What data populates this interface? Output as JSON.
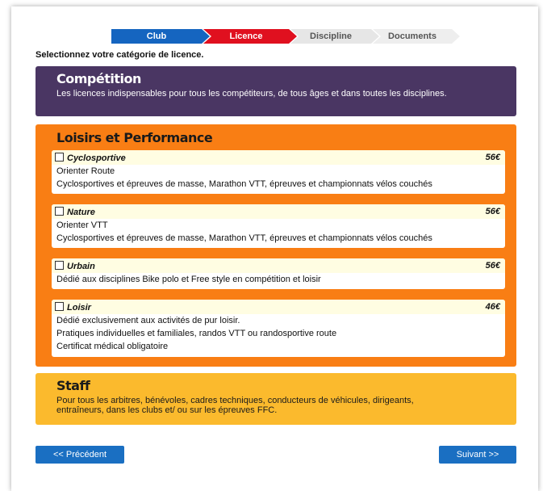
{
  "stepper": {
    "steps": [
      {
        "label": "Club"
      },
      {
        "label": "Licence"
      },
      {
        "label": "Discipline"
      },
      {
        "label": "Documents"
      }
    ]
  },
  "instruction": "Selectionnez votre catégorie de licence.",
  "competition": {
    "title": "Compétition",
    "description": "Les licences indispensables pour tous les compétiteurs, de tous âges et dans toutes les disciplines."
  },
  "loisirs": {
    "title": "Loisirs et Performance",
    "cards": [
      {
        "name": "Cyclosportive",
        "price": "56€",
        "lines": [
          "Orienter Route",
          "Cyclosportives et épreuves de masse, Marathon VTT, épreuves et championnats vélos couchés"
        ]
      },
      {
        "name": "Nature",
        "price": "56€",
        "lines": [
          "Orienter VTT",
          "Cyclosportives et épreuves de masse, Marathon VTT, épreuves et championnats vélos couchés"
        ]
      },
      {
        "name": "Urbain",
        "price": "56€",
        "lines": [
          "Dédié aux disciplines Bike polo et Free style en compétition et loisir"
        ]
      },
      {
        "name": "Loisir",
        "price": "46€",
        "lines": [
          "Dédié exclusivement aux activités de pur loisir.",
          "Pratiques individuelles et familiales, randos VTT ou randosportive route",
          "Certificat médical obligatoire"
        ]
      }
    ]
  },
  "staff": {
    "title": "Staff",
    "description": "Pour tous les arbitres, bénévoles, cadres techniques, conducteurs de véhicules, dirigeants, entraîneurs, dans les clubs et/ ou sur les épreuves FFC."
  },
  "nav": {
    "prev_label": "<< Précédent",
    "next_label": "Suivant >>"
  },
  "colors": {
    "competition": "#4a3663",
    "loisirs": "#f97e14",
    "staff": "#fbba2d",
    "step_active": "#e0101f",
    "step_done": "#1565c0",
    "button": "#1a6fc2"
  }
}
